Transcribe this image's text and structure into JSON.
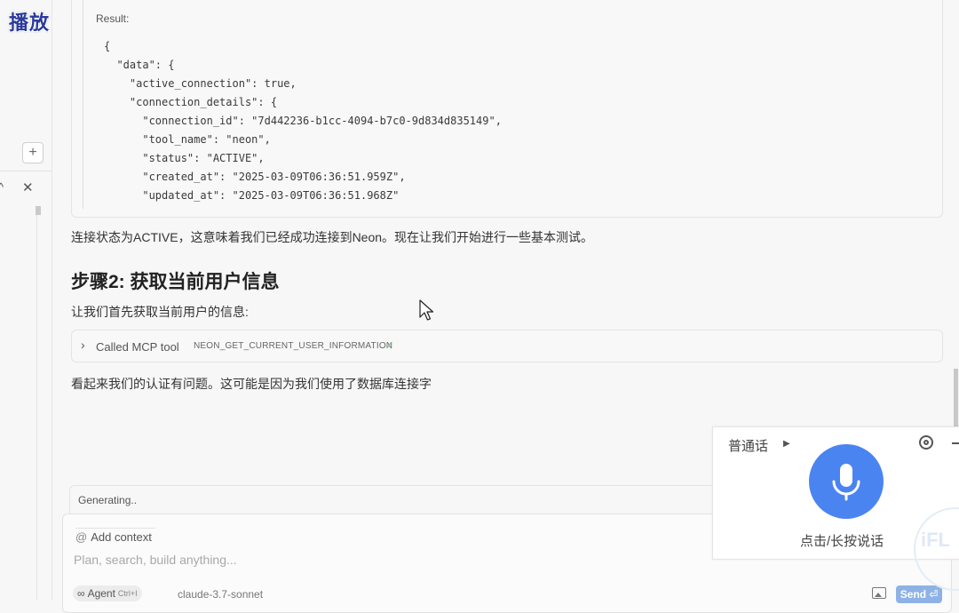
{
  "overlay": {
    "play_label": "播放"
  },
  "sidebar": {
    "add_label": "+",
    "chevron": "^",
    "close": "✕"
  },
  "result": {
    "label": "Result:",
    "code": "{\n  \"data\": {\n    \"active_connection\": true,\n    \"connection_details\": {\n      \"connection_id\": \"7d442236-b1cc-4094-b7c0-9d834d835149\",\n      \"tool_name\": \"neon\",\n      \"status\": \"ACTIVE\",\n      \"created_at\": \"2025-03-09T06:36:51.959Z\",\n      \"updated_at\": \"2025-03-09T06:36:51.968Z\""
  },
  "messages": {
    "status_text": "连接状态为ACTIVE，这意味着我们已经成功连接到Neon。现在让我们开始进行一些基本测试。",
    "step_heading": "步骤2: 获取当前用户信息",
    "step_intro": "让我们首先获取当前用户的信息:",
    "followup_text": "看起来我们的认证有问题。这可能是因为我们使用了数据库连接字"
  },
  "tool_call": {
    "chevron": "›",
    "label": "Called MCP tool",
    "name": "NEON_GET_CURRENT_USER_INFORMATION",
    "check": "✓"
  },
  "composer": {
    "generating_text": "Generating..",
    "add_context_label": "Add context",
    "at_symbol": "@",
    "placeholder": "Plan, search, build anything...",
    "agent_label": "Agent",
    "agent_symbol": "∞",
    "agent_shortcut": "Ctrl+I",
    "model_label": "claude-3.7-sonnet",
    "send_label": "Send",
    "send_symbol": "⏎"
  },
  "voice": {
    "language": "普通话",
    "language_arrow": "▶",
    "hint": "点击/长按说话",
    "watermark": "iFL",
    "mic_color": "#4a84f0"
  },
  "colors": {
    "accent": "#4a84f0",
    "send_button": "#8fb2e6",
    "check": "#7cb98a",
    "play_label": "#2b3a9c"
  }
}
